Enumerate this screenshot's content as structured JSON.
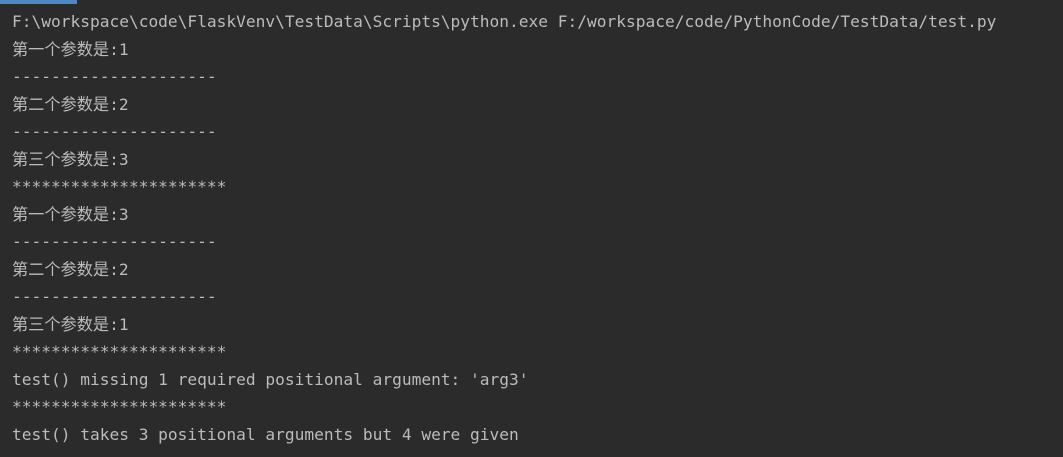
{
  "theme": {
    "background": "#2b2b2b",
    "text_color": "#bbbbbb",
    "accent": "#4a88c7"
  },
  "console": {
    "lines": [
      "F:\\workspace\\code\\FlaskVenv\\TestData\\Scripts\\python.exe F:/workspace/code/PythonCode/TestData/test.py",
      "第一个参数是:1",
      "---------------------",
      "第二个参数是:2",
      "---------------------",
      "第三个参数是:3",
      "**********************",
      "第一个参数是:3",
      "---------------------",
      "第二个参数是:2",
      "---------------------",
      "第三个参数是:1",
      "**********************",
      "test() missing 1 required positional argument: 'arg3'",
      "**********************",
      "test() takes 3 positional arguments but 4 were given"
    ]
  }
}
